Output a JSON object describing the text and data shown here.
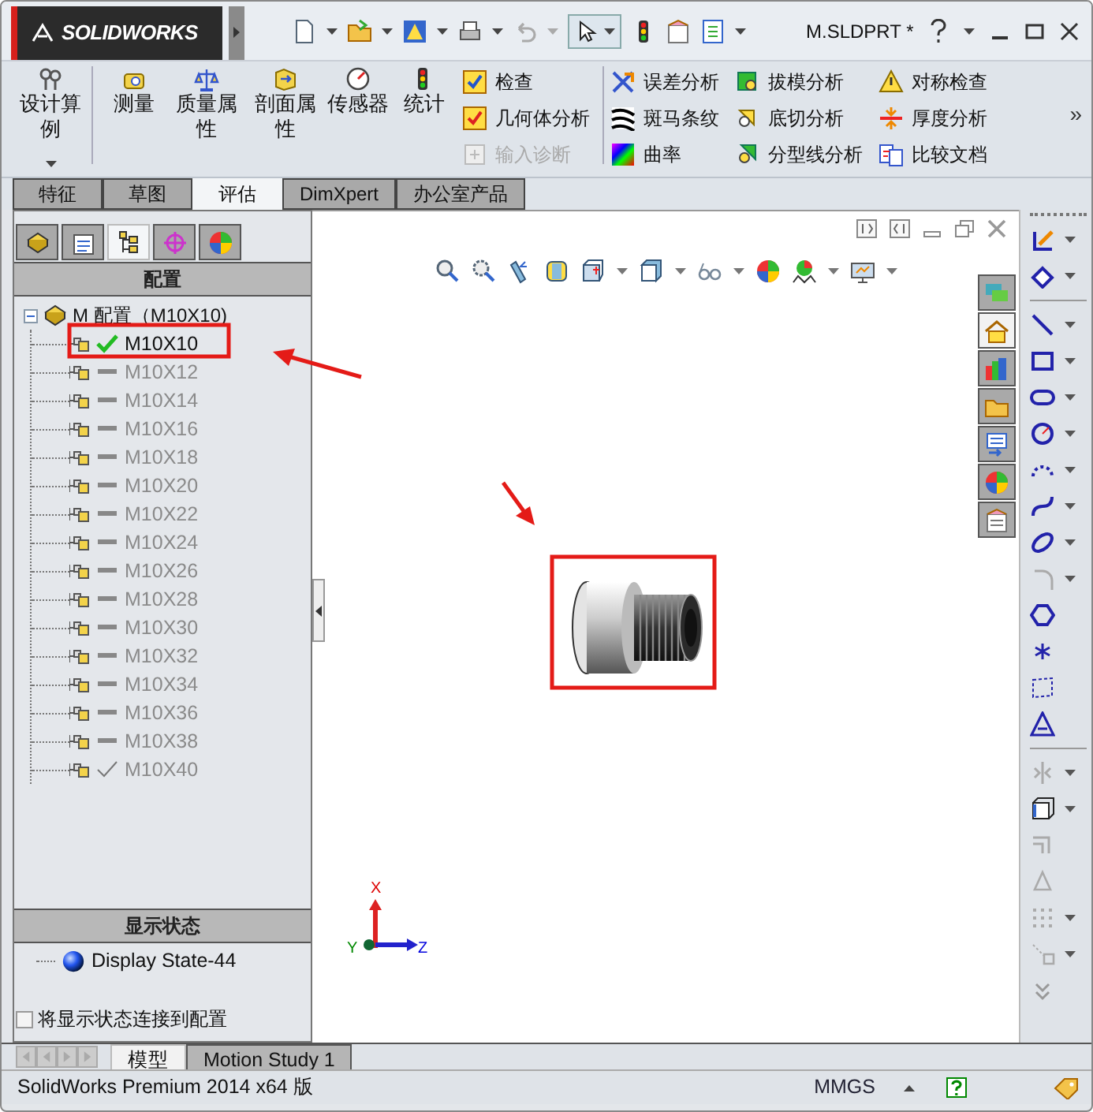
{
  "window": {
    "logo": "SOLIDWORKS",
    "title": "M.SLDPRT *"
  },
  "ribbon": {
    "large_buttons": [
      {
        "label": "设计算例",
        "dropdown": true
      },
      {
        "label": "测量",
        "dropdown": false
      },
      {
        "label": "质量属性",
        "dropdown": false
      },
      {
        "label": "剖面属性",
        "dropdown": false
      },
      {
        "label": "传感器",
        "dropdown": false
      },
      {
        "label": "统计",
        "dropdown": false
      }
    ],
    "check_items": [
      {
        "label": "检查",
        "disabled": false
      },
      {
        "label": "几何体分析",
        "disabled": false
      },
      {
        "label": "输入诊断",
        "disabled": true
      }
    ],
    "analysis_columns": [
      [
        {
          "label": "误差分析"
        },
        {
          "label": "斑马条纹"
        },
        {
          "label": "曲率"
        }
      ],
      [
        {
          "label": "拔模分析"
        },
        {
          "label": "底切分析"
        },
        {
          "label": "分型线分析"
        }
      ],
      [
        {
          "label": "对称检查"
        },
        {
          "label": "厚度分析"
        },
        {
          "label": "比较文档"
        }
      ]
    ],
    "more": "»"
  },
  "command_tabs": [
    {
      "label": "特征",
      "selected": false
    },
    {
      "label": "草图",
      "selected": false
    },
    {
      "label": "评估",
      "selected": true
    },
    {
      "label": "DimXpert",
      "selected": false
    },
    {
      "label": "办公室产品",
      "selected": false
    }
  ],
  "task_pane_tabs": [
    {
      "selected": false
    },
    {
      "selected": true
    },
    {
      "selected": false
    },
    {
      "selected": false
    },
    {
      "selected": false
    },
    {
      "selected": false
    },
    {
      "selected": false
    }
  ],
  "panel_tabs": [
    {
      "selected": false
    },
    {
      "selected": false
    },
    {
      "selected": true
    },
    {
      "selected": false
    },
    {
      "selected": false
    }
  ],
  "configurations": {
    "header": "配置",
    "root": {
      "label": "M 配置（M10X10)",
      "expanded": true,
      "children": [
        {
          "label": "M10X10",
          "kind": "active"
        },
        {
          "label": "M10X12",
          "kind": "inactive"
        },
        {
          "label": "M10X14",
          "kind": "inactive"
        },
        {
          "label": "M10X16",
          "kind": "inactive"
        },
        {
          "label": "M10X18",
          "kind": "inactive"
        },
        {
          "label": "M10X20",
          "kind": "inactive"
        },
        {
          "label": "M10X22",
          "kind": "inactive"
        },
        {
          "label": "M10X24",
          "kind": "inactive"
        },
        {
          "label": "M10X26",
          "kind": "inactive"
        },
        {
          "label": "M10X28",
          "kind": "inactive"
        },
        {
          "label": "M10X30",
          "kind": "inactive"
        },
        {
          "label": "M10X32",
          "kind": "inactive"
        },
        {
          "label": "M10X34",
          "kind": "inactive"
        },
        {
          "label": "M10X36",
          "kind": "inactive"
        },
        {
          "label": "M10X38",
          "kind": "inactive"
        },
        {
          "label": "M10X40",
          "kind": "marked"
        }
      ]
    }
  },
  "display_states": {
    "header": "显示状态",
    "items": [
      {
        "label": "Display State-44"
      }
    ],
    "link_option": {
      "label": "将显示状态连接到配置",
      "checked": false
    }
  },
  "viewport": {
    "triad": {
      "x": "X",
      "y": "Y",
      "z": "Z"
    }
  },
  "bottom_tabs": [
    {
      "label": "模型",
      "selected": true
    },
    {
      "label": "Motion Study 1",
      "selected": false
    }
  ],
  "status_bar": {
    "product": "SolidWorks Premium 2014 x64 版",
    "units": "MMGS"
  }
}
